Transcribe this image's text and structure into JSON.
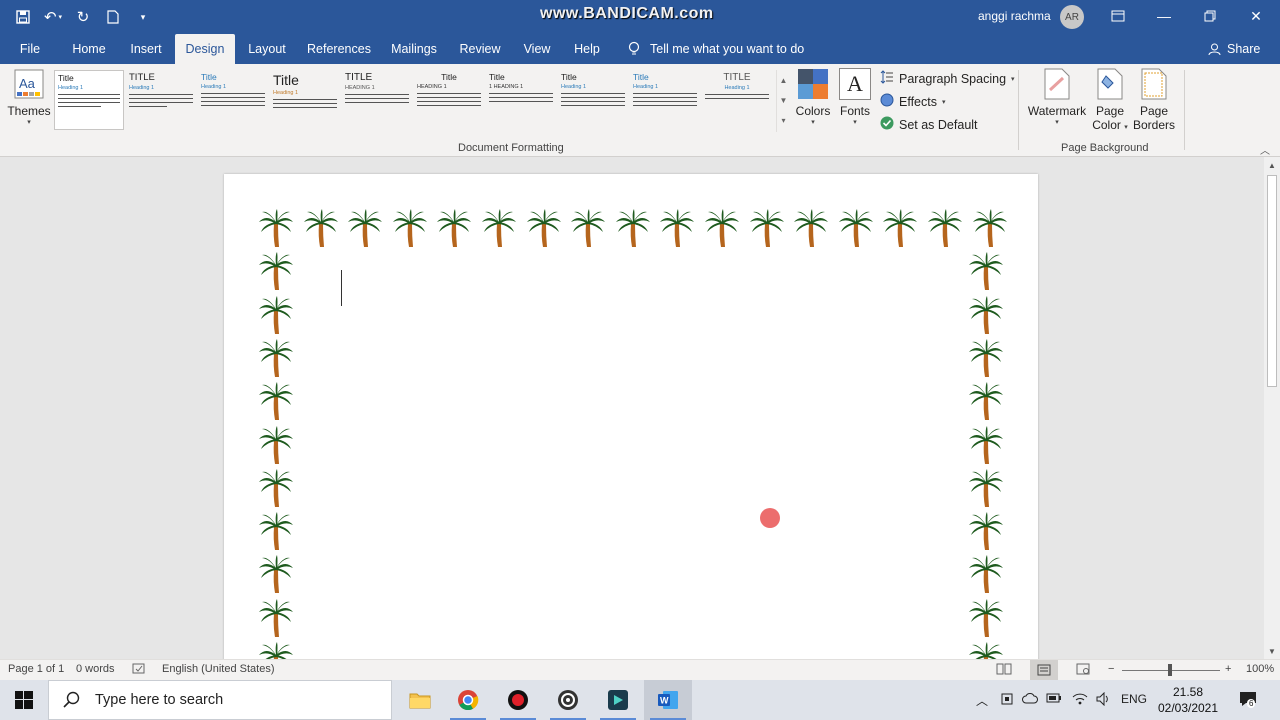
{
  "titlebar": {
    "recording_watermark": "www.BANDICAM.com",
    "user_name": "anggi rachma",
    "avatar_initials": "AR"
  },
  "tabs": [
    {
      "label": "File"
    },
    {
      "label": "Home"
    },
    {
      "label": "Insert"
    },
    {
      "label": "Design",
      "active": true
    },
    {
      "label": "Layout"
    },
    {
      "label": "References"
    },
    {
      "label": "Mailings"
    },
    {
      "label": "Review"
    },
    {
      "label": "View"
    },
    {
      "label": "Help"
    }
  ],
  "tell_me": "Tell me what you want to do",
  "share": "Share",
  "ribbon": {
    "themes_label": "Themes",
    "style_set_titles": [
      "Title",
      "TITLE",
      "Title",
      "Title",
      "TITLE",
      "Title",
      "Title",
      "Title",
      "Title",
      "TITLE"
    ],
    "colors_label": "Colors",
    "fonts_label": "Fonts",
    "paragraph_spacing": "Paragraph Spacing",
    "effects": "Effects",
    "set_as_default": "Set as Default",
    "document_formatting": "Document Formatting",
    "watermark_label": "Watermark",
    "page_color_line1": "Page",
    "page_color_line2": "Color",
    "page_borders_line1": "Page",
    "page_borders_line2": "Borders",
    "page_background": "Page Background"
  },
  "status": {
    "page": "Page 1 of 1",
    "words": "0 words",
    "language": "English (United States)",
    "zoom": "100%"
  },
  "taskbar": {
    "search_placeholder": "Type here to search",
    "language": "ENG",
    "time": "21.58",
    "date": "02/03/2021",
    "notification_count": "6"
  },
  "colors": {
    "word_blue": "#2b579a",
    "ribbon_bg": "#f3f2f1",
    "palm_trunk": "#b5651d",
    "palm_leaf": "#1e5a1e"
  }
}
